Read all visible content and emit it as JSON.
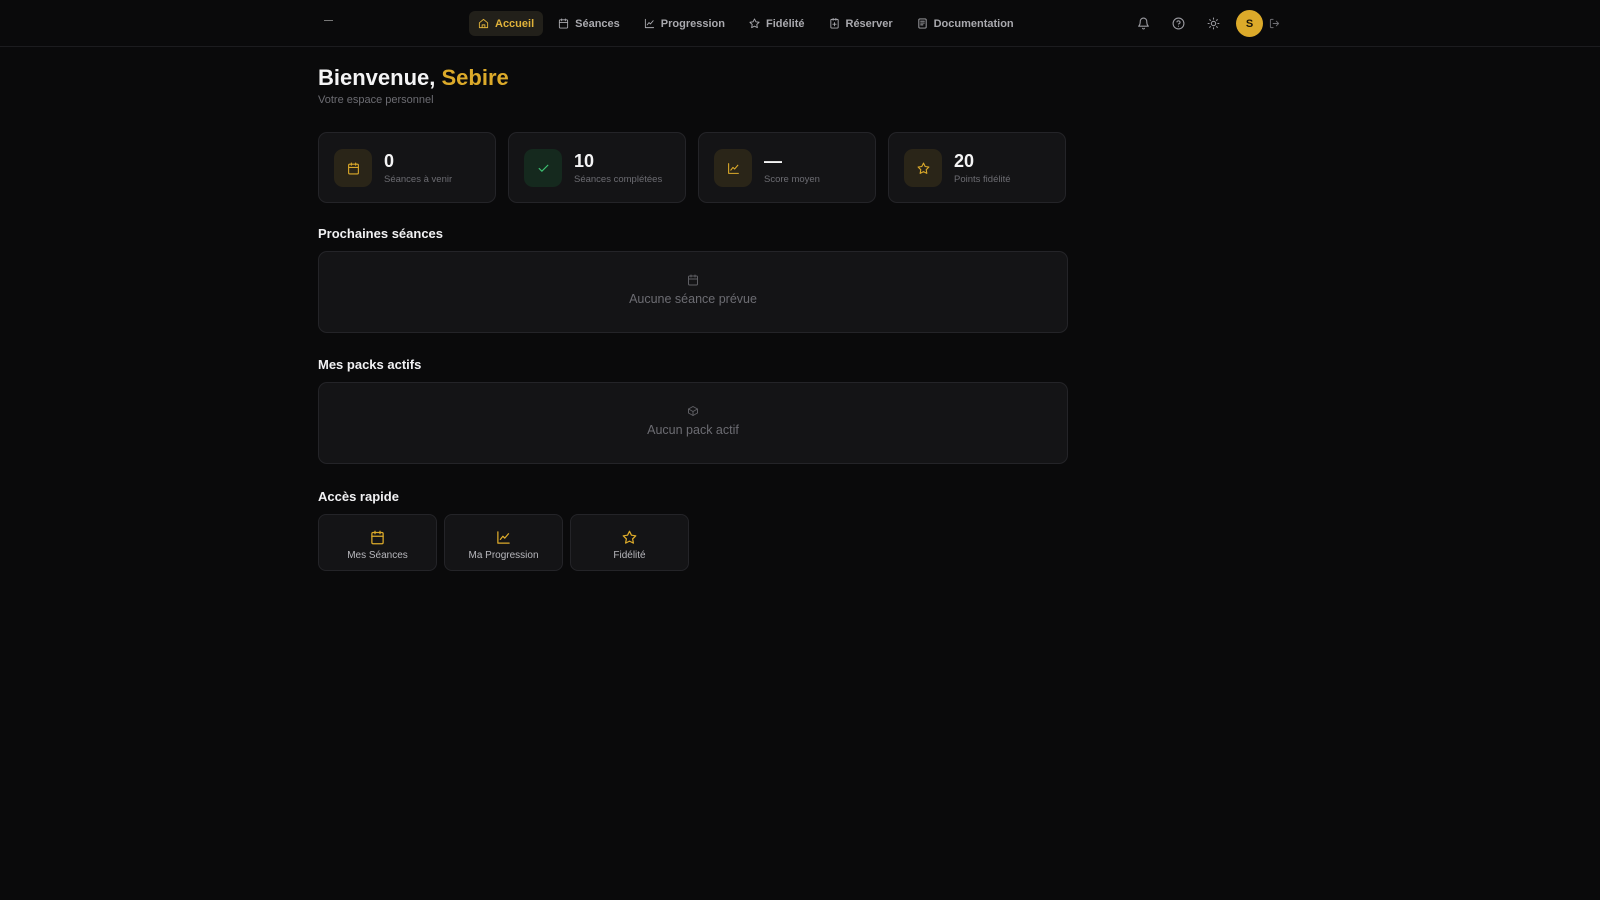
{
  "nav": {
    "items": [
      {
        "label": "Accueil",
        "icon": "home-icon",
        "active": true
      },
      {
        "label": "Séances",
        "icon": "calendar-icon"
      },
      {
        "label": "Progression",
        "icon": "chart-line-icon"
      },
      {
        "label": "Fidélité",
        "icon": "star-icon"
      },
      {
        "label": "Réserver",
        "icon": "calendar-plus-icon"
      },
      {
        "label": "Documentation",
        "icon": "document-icon"
      }
    ],
    "avatar_initial": "S"
  },
  "header": {
    "greeting": "Bienvenue,",
    "name": "Sebire",
    "subtitle": "Votre espace personnel"
  },
  "stats": [
    {
      "value": "0",
      "label": "Séances à venir",
      "icon": "calendar-icon",
      "tone": "gold"
    },
    {
      "value": "10",
      "label": "Séances complétées",
      "icon": "check-icon",
      "tone": "green"
    },
    {
      "value": "—",
      "label": "Score moyen",
      "icon": "chart-line-icon",
      "tone": "gold"
    },
    {
      "value": "20",
      "label": "Points fidélité",
      "icon": "star-icon",
      "tone": "gold"
    }
  ],
  "upcoming": {
    "title": "Prochaines séances",
    "empty_text": "Aucune séance prévue"
  },
  "packs": {
    "title": "Mes packs actifs",
    "empty_text": "Aucun pack actif"
  },
  "quick_access": {
    "title": "Accès rapide",
    "items": [
      {
        "label": "Mes Séances",
        "icon": "calendar-icon"
      },
      {
        "label": "Ma Progression",
        "icon": "chart-line-icon"
      },
      {
        "label": "Fidélité",
        "icon": "star-icon"
      }
    ]
  },
  "colors": {
    "accent": "#dcaa2a",
    "background": "#0a0a0b",
    "card": "#141416",
    "success": "#3dc172"
  }
}
